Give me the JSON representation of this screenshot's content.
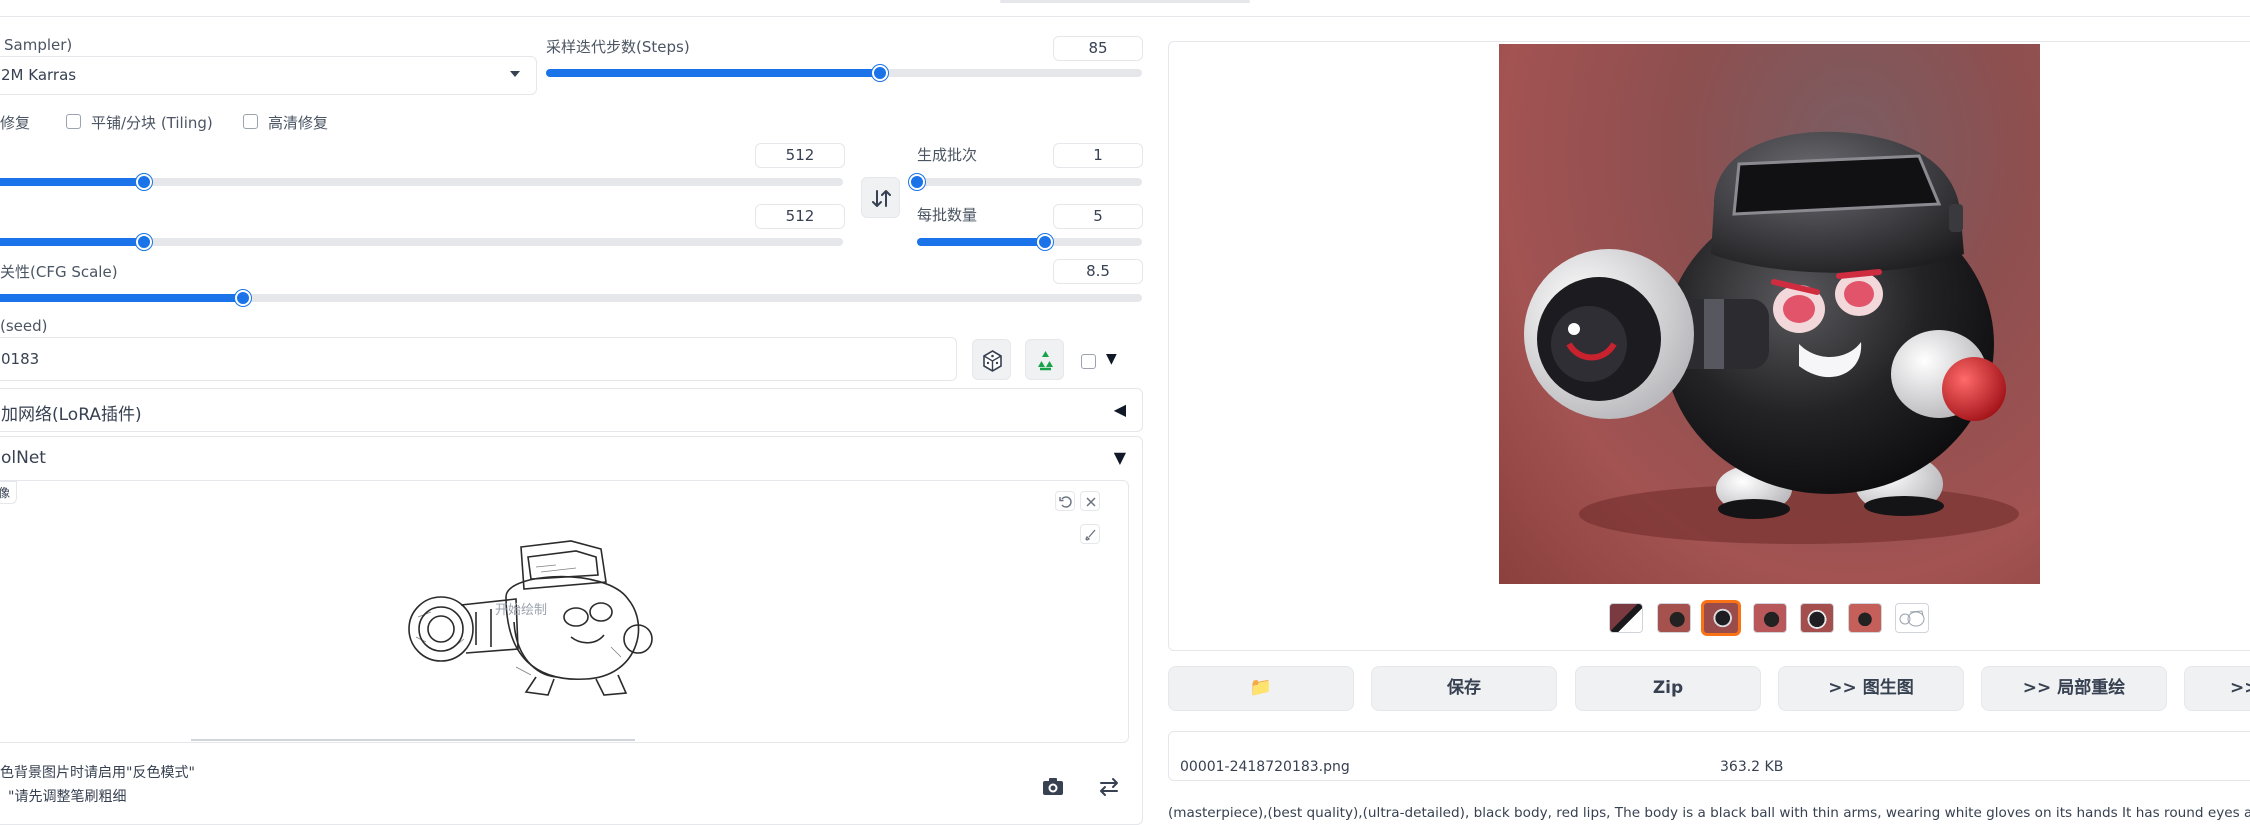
{
  "left": {
    "sampler_label": "Sampler)",
    "sampler_value": "2M Karras",
    "steps_label": "采样迭代步数(Steps)",
    "steps_value": "85",
    "steps_fraction": 0.56,
    "face_restore_label": "修复",
    "tiling_label": "平铺/分块 (Tiling)",
    "hires_label": "高清修复",
    "width_value": "512",
    "width_fraction": 0.18,
    "height_value": "512",
    "height_fraction": 0.18,
    "batch_count_label": "生成批次",
    "batch_count_value": "1",
    "batch_count_fraction": 0.0,
    "batch_size_label": "每批数量",
    "batch_size_value": "5",
    "batch_size_fraction": 0.57,
    "cfg_label": "关性(CFG Scale)",
    "cfg_value": "8.5",
    "cfg_fraction": 0.22,
    "seed_label": "(seed)",
    "seed_value": "0183",
    "lora_label": "加网络(LoRA插件)",
    "lora_arrow": "◀",
    "controlnet_label": "olNet",
    "controlnet_arrow": "▼",
    "canvas_tag": "像",
    "canvas_hint": "开始绘制",
    "note_line1": "色背景图片时请启用\"反色模式\"",
    "note_line2": "\"请先调整笔刷粗细",
    "dropdown_caret": "▼",
    "icons": [
      "swap-dimensions-icon",
      "dice-icon",
      "recycle-icon",
      "undo-icon",
      "close-icon",
      "brush-icon",
      "camera-icon",
      "swap-icon",
      "folder-icon"
    ]
  },
  "right": {
    "buttons": {
      "folder": "📁",
      "save": "保存",
      "zip": "Zip",
      "img2img": ">> 图生图",
      "inpaint": ">> 局部重绘",
      "more": ">>"
    },
    "file_name": "00001-2418720183.png",
    "file_size": "363.2 KB",
    "prompt_text": "(masterpiece),(best quality),(ultra-detailed), black body, red lips, The body is a black ball with thin arms, wearing white gloves on its hands It has round eyes and thick",
    "thumbnail_count": 7,
    "selected_thumbnail_index": 2,
    "accent_color": "#1a73e8",
    "selected_border_color": "#f97316"
  }
}
